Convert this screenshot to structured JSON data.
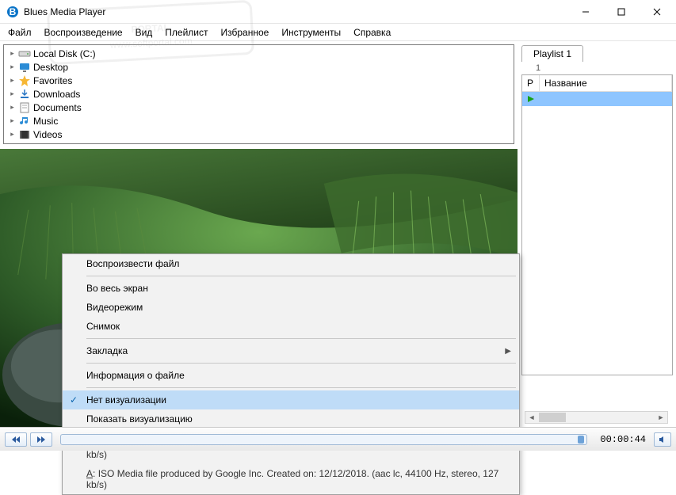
{
  "window": {
    "title": "Blues Media Player"
  },
  "window_controls": {
    "min": "—",
    "max": "▢",
    "close": "✕"
  },
  "menu": {
    "file": "Файл",
    "playback": "Воспроизведение",
    "view": "Вид",
    "playlist": "Плейлист",
    "favorites": "Избранное",
    "tools": "Инструменты",
    "help": "Справка"
  },
  "tree": {
    "items": [
      {
        "label": "Local Disk (C:)",
        "icon": "drive"
      },
      {
        "label": "Desktop",
        "icon": "monitor"
      },
      {
        "label": "Favorites",
        "icon": "star"
      },
      {
        "label": "Downloads",
        "icon": "download"
      },
      {
        "label": "Documents",
        "icon": "doc"
      },
      {
        "label": "Music",
        "icon": "music"
      },
      {
        "label": "Videos",
        "icon": "video"
      }
    ]
  },
  "playlist": {
    "tab": "Playlist 1",
    "count": "1",
    "columns": {
      "p": "P",
      "name": "Название"
    }
  },
  "context_menu": {
    "play_file": "Воспроизвести файл",
    "fullscreen": "Во весь экран",
    "video_mode": "Видеорежим",
    "snapshot": "Снимок",
    "bookmark": "Закладка",
    "file_info": "Информация о файле",
    "no_visual": "Нет визуализации",
    "show_visual": "Показать визуализацию",
    "info_a": "A: ISO Media file produced by Google Inc. Created on: 12/12/2018. (aac lc, 44100 Hz, stereo, 127 kb/s)",
    "info_b": "A: ISO Media file produced by Google Inc. Created on: 12/12/2018. (aac lc, 44100 Hz, stereo, 127 kb/s)"
  },
  "transport": {
    "time": "00:00:44"
  }
}
